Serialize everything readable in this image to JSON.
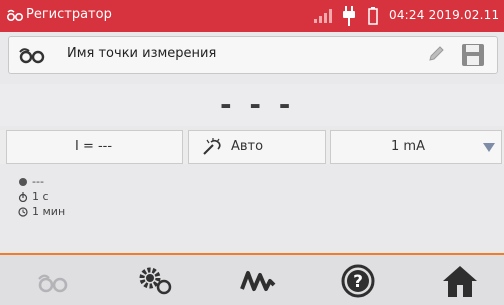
{
  "titlebar": {
    "title": "Регистратор",
    "datetime": "04:24 2019.02.11",
    "accent_color": "#d7333e"
  },
  "point": {
    "label": "Имя точки измерения",
    "icons": [
      "recorder-icon",
      "pencil-icon",
      "save-icon"
    ]
  },
  "readout": {
    "value": "- - -"
  },
  "params": {
    "current_label": "I = ---",
    "mode_label": "Авто",
    "range_value": "1 mA"
  },
  "info": {
    "status": "---",
    "interval": "1 с",
    "duration": "1 мин"
  },
  "bottombar": {
    "icons": [
      "recorder-icon",
      "settings-icon",
      "waveform-icon",
      "help-icon",
      "home-icon"
    ],
    "accent_color": "#f07d2c"
  }
}
